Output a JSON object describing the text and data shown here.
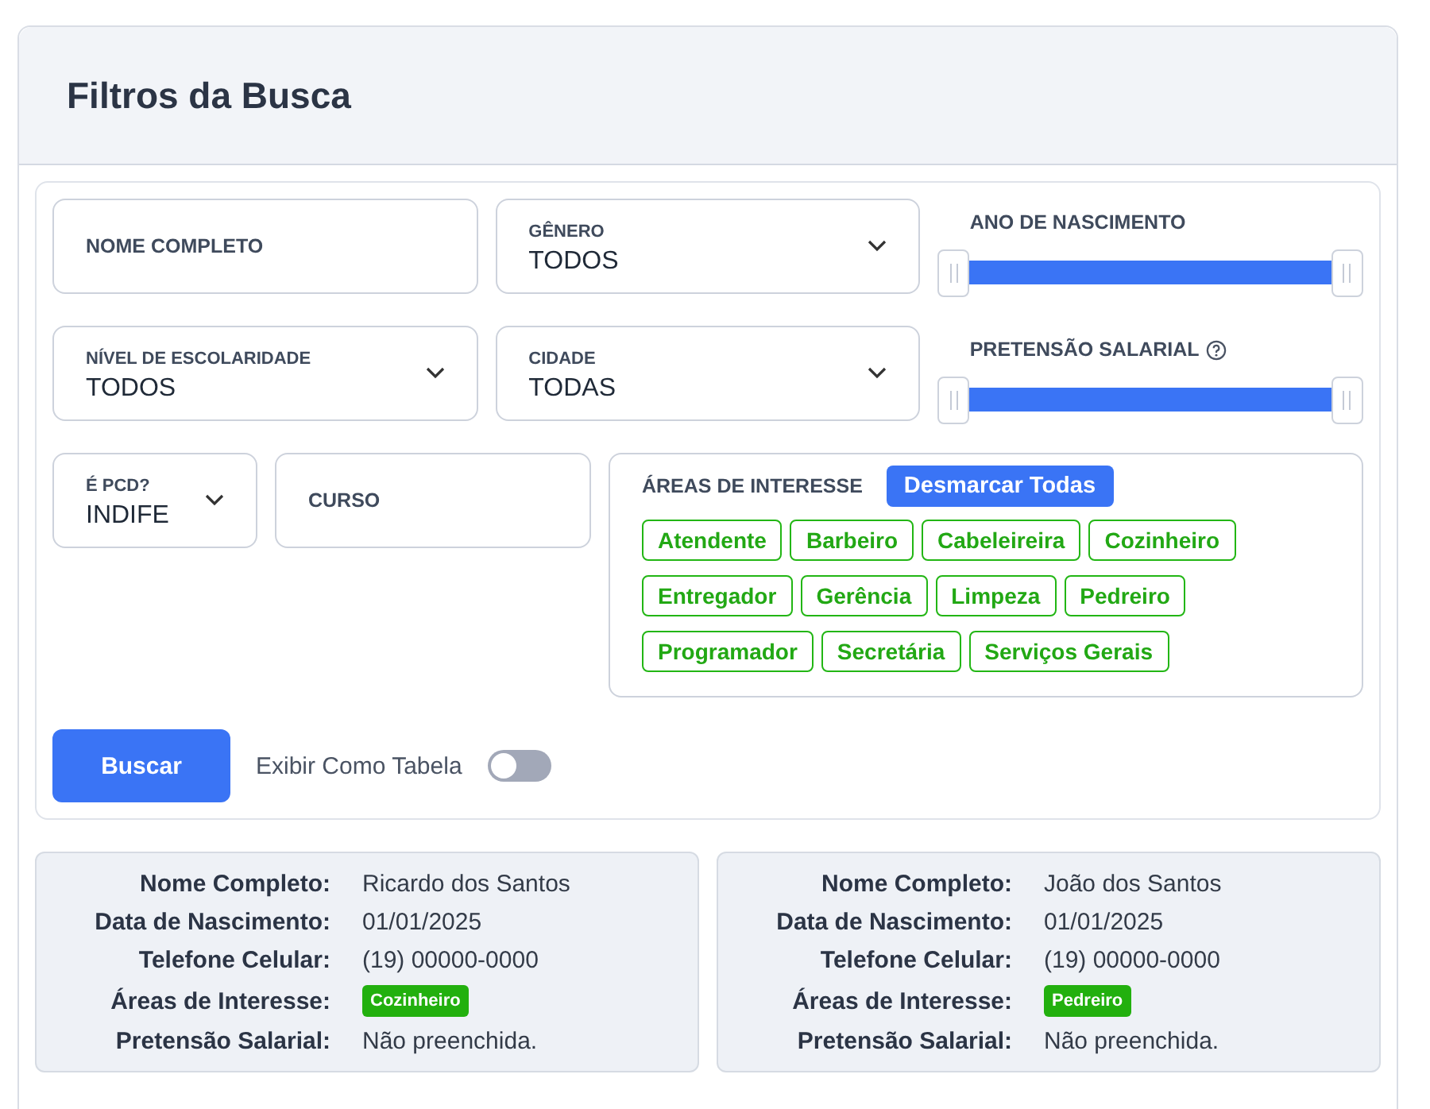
{
  "panel": {
    "title": "Filtros da Busca"
  },
  "fields": [
    {
      "kind": "text",
      "label": "NOME COMPLETO"
    },
    {
      "kind": "select",
      "label": "GÊNERO",
      "value": "TODOS"
    },
    {
      "kind": "range",
      "label": "ANO DE NASCIMENTO",
      "level": 1
    },
    {
      "kind": "select",
      "label": "NÍVEL DE ESCOLARIDADE",
      "value": "TODOS"
    },
    {
      "kind": "select",
      "label": "CIDADE",
      "value": "TODAS"
    },
    {
      "kind": "range",
      "label": "PRETENSÃO SALARIAL",
      "level": 1,
      "help": true
    }
  ],
  "pcd": {
    "label": "É PCD?",
    "value": "INDIFE"
  },
  "course": {
    "label": "CURSO"
  },
  "areas": {
    "label": "ÁREAS DE INTERESSE",
    "clear_button": "Desmarcar Todas",
    "chips": [
      "Atendente",
      "Barbeiro",
      "Cabeleireira",
      "Cozinheiro",
      "Entregador",
      "Gerência",
      "Limpeza",
      "Pedreiro",
      "Programador",
      "Secretária",
      "Serviços Gerais"
    ]
  },
  "search_button": "Buscar",
  "table_toggle": {
    "label": "Exibir Como Tabela",
    "on": false
  },
  "results": [
    {
      "rows": [
        {
          "label": "Nome Completo:",
          "kind": "text",
          "value": "Ricardo dos Santos"
        },
        {
          "label": "Data de Nascimento:",
          "kind": "text",
          "value": "01/01/2025"
        },
        {
          "label": "Telefone Celular:",
          "kind": "text",
          "value": "(19) 00000-0000"
        },
        {
          "label": "Áreas de Interesse:",
          "kind": "tags",
          "tags": [
            "Cozinheiro"
          ]
        },
        {
          "label": "Pretensão Salarial:",
          "kind": "text",
          "value": "Não preenchida."
        }
      ]
    },
    {
      "rows": [
        {
          "label": "Nome Completo:",
          "kind": "text",
          "value": "João dos Santos"
        },
        {
          "label": "Data de Nascimento:",
          "kind": "text",
          "value": "01/01/2025"
        },
        {
          "label": "Telefone Celular:",
          "kind": "text",
          "value": "(19) 00000-0000"
        },
        {
          "label": "Áreas de Interesse:",
          "kind": "tags",
          "tags": [
            "Pedreiro"
          ]
        },
        {
          "label": "Pretensão Salarial:",
          "kind": "text",
          "value": "Não preenchida."
        }
      ]
    }
  ]
}
